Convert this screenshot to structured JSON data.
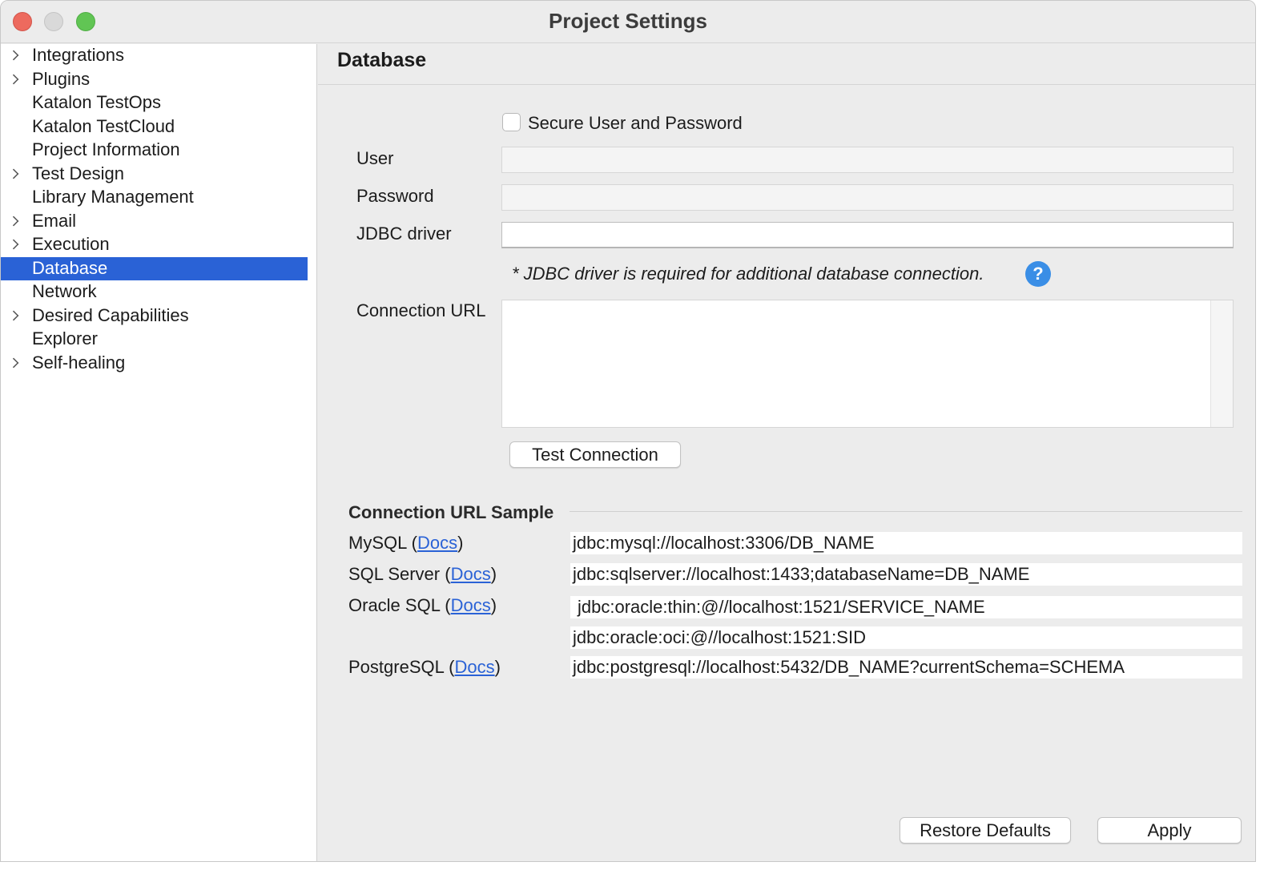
{
  "window": {
    "title": "Project Settings"
  },
  "sidebar": {
    "items": [
      {
        "label": "Integrations",
        "expandable": true,
        "selected": false
      },
      {
        "label": "Plugins",
        "expandable": true,
        "selected": false
      },
      {
        "label": "Katalon TestOps",
        "expandable": false,
        "selected": false
      },
      {
        "label": "Katalon TestCloud",
        "expandable": false,
        "selected": false
      },
      {
        "label": "Project Information",
        "expandable": false,
        "selected": false
      },
      {
        "label": "Test Design",
        "expandable": true,
        "selected": false
      },
      {
        "label": "Library Management",
        "expandable": false,
        "selected": false
      },
      {
        "label": "Email",
        "expandable": true,
        "selected": false
      },
      {
        "label": "Execution",
        "expandable": true,
        "selected": false
      },
      {
        "label": "Database",
        "expandable": false,
        "selected": true
      },
      {
        "label": "Network",
        "expandable": false,
        "selected": false
      },
      {
        "label": "Desired Capabilities",
        "expandable": true,
        "selected": false
      },
      {
        "label": "Explorer",
        "expandable": false,
        "selected": false
      },
      {
        "label": "Self-healing",
        "expandable": true,
        "selected": false
      }
    ]
  },
  "main": {
    "heading": "Database",
    "secure_checkbox": {
      "label": "Secure User and Password",
      "checked": false
    },
    "user": {
      "label": "User",
      "value": ""
    },
    "password": {
      "label": "Password",
      "value": ""
    },
    "jdbc": {
      "label": "JDBC driver",
      "value": ""
    },
    "jdbc_hint": "* JDBC driver is required for additional database connection.",
    "help_icon": "?",
    "connection_url": {
      "label": "Connection URL",
      "value": ""
    },
    "test_connection_label": "Test Connection",
    "samples": {
      "title": "Connection URL Sample",
      "docs_label": "Docs",
      "mysql": {
        "name": "MySQL",
        "url": "jdbc:mysql://localhost:3306/DB_NAME"
      },
      "sqlserver": {
        "name": "SQL Server",
        "url": "jdbc:sqlserver://localhost:1433;databaseName=DB_NAME"
      },
      "oracle": {
        "name": "Oracle SQL",
        "url1": "jdbc:oracle:thin:@//localhost:1521/SERVICE_NAME",
        "url2": "jdbc:oracle:oci:@//localhost:1521:SID"
      },
      "postgres": {
        "name": "PostgreSQL",
        "url": "jdbc:postgresql://localhost:5432/DB_NAME?currentSchema=SCHEMA"
      }
    },
    "restore_label": "Restore Defaults",
    "apply_label": "Apply"
  },
  "colors": {
    "selection": "#2a62d6",
    "link": "#2a62d6",
    "help": "#3a8ee6"
  }
}
